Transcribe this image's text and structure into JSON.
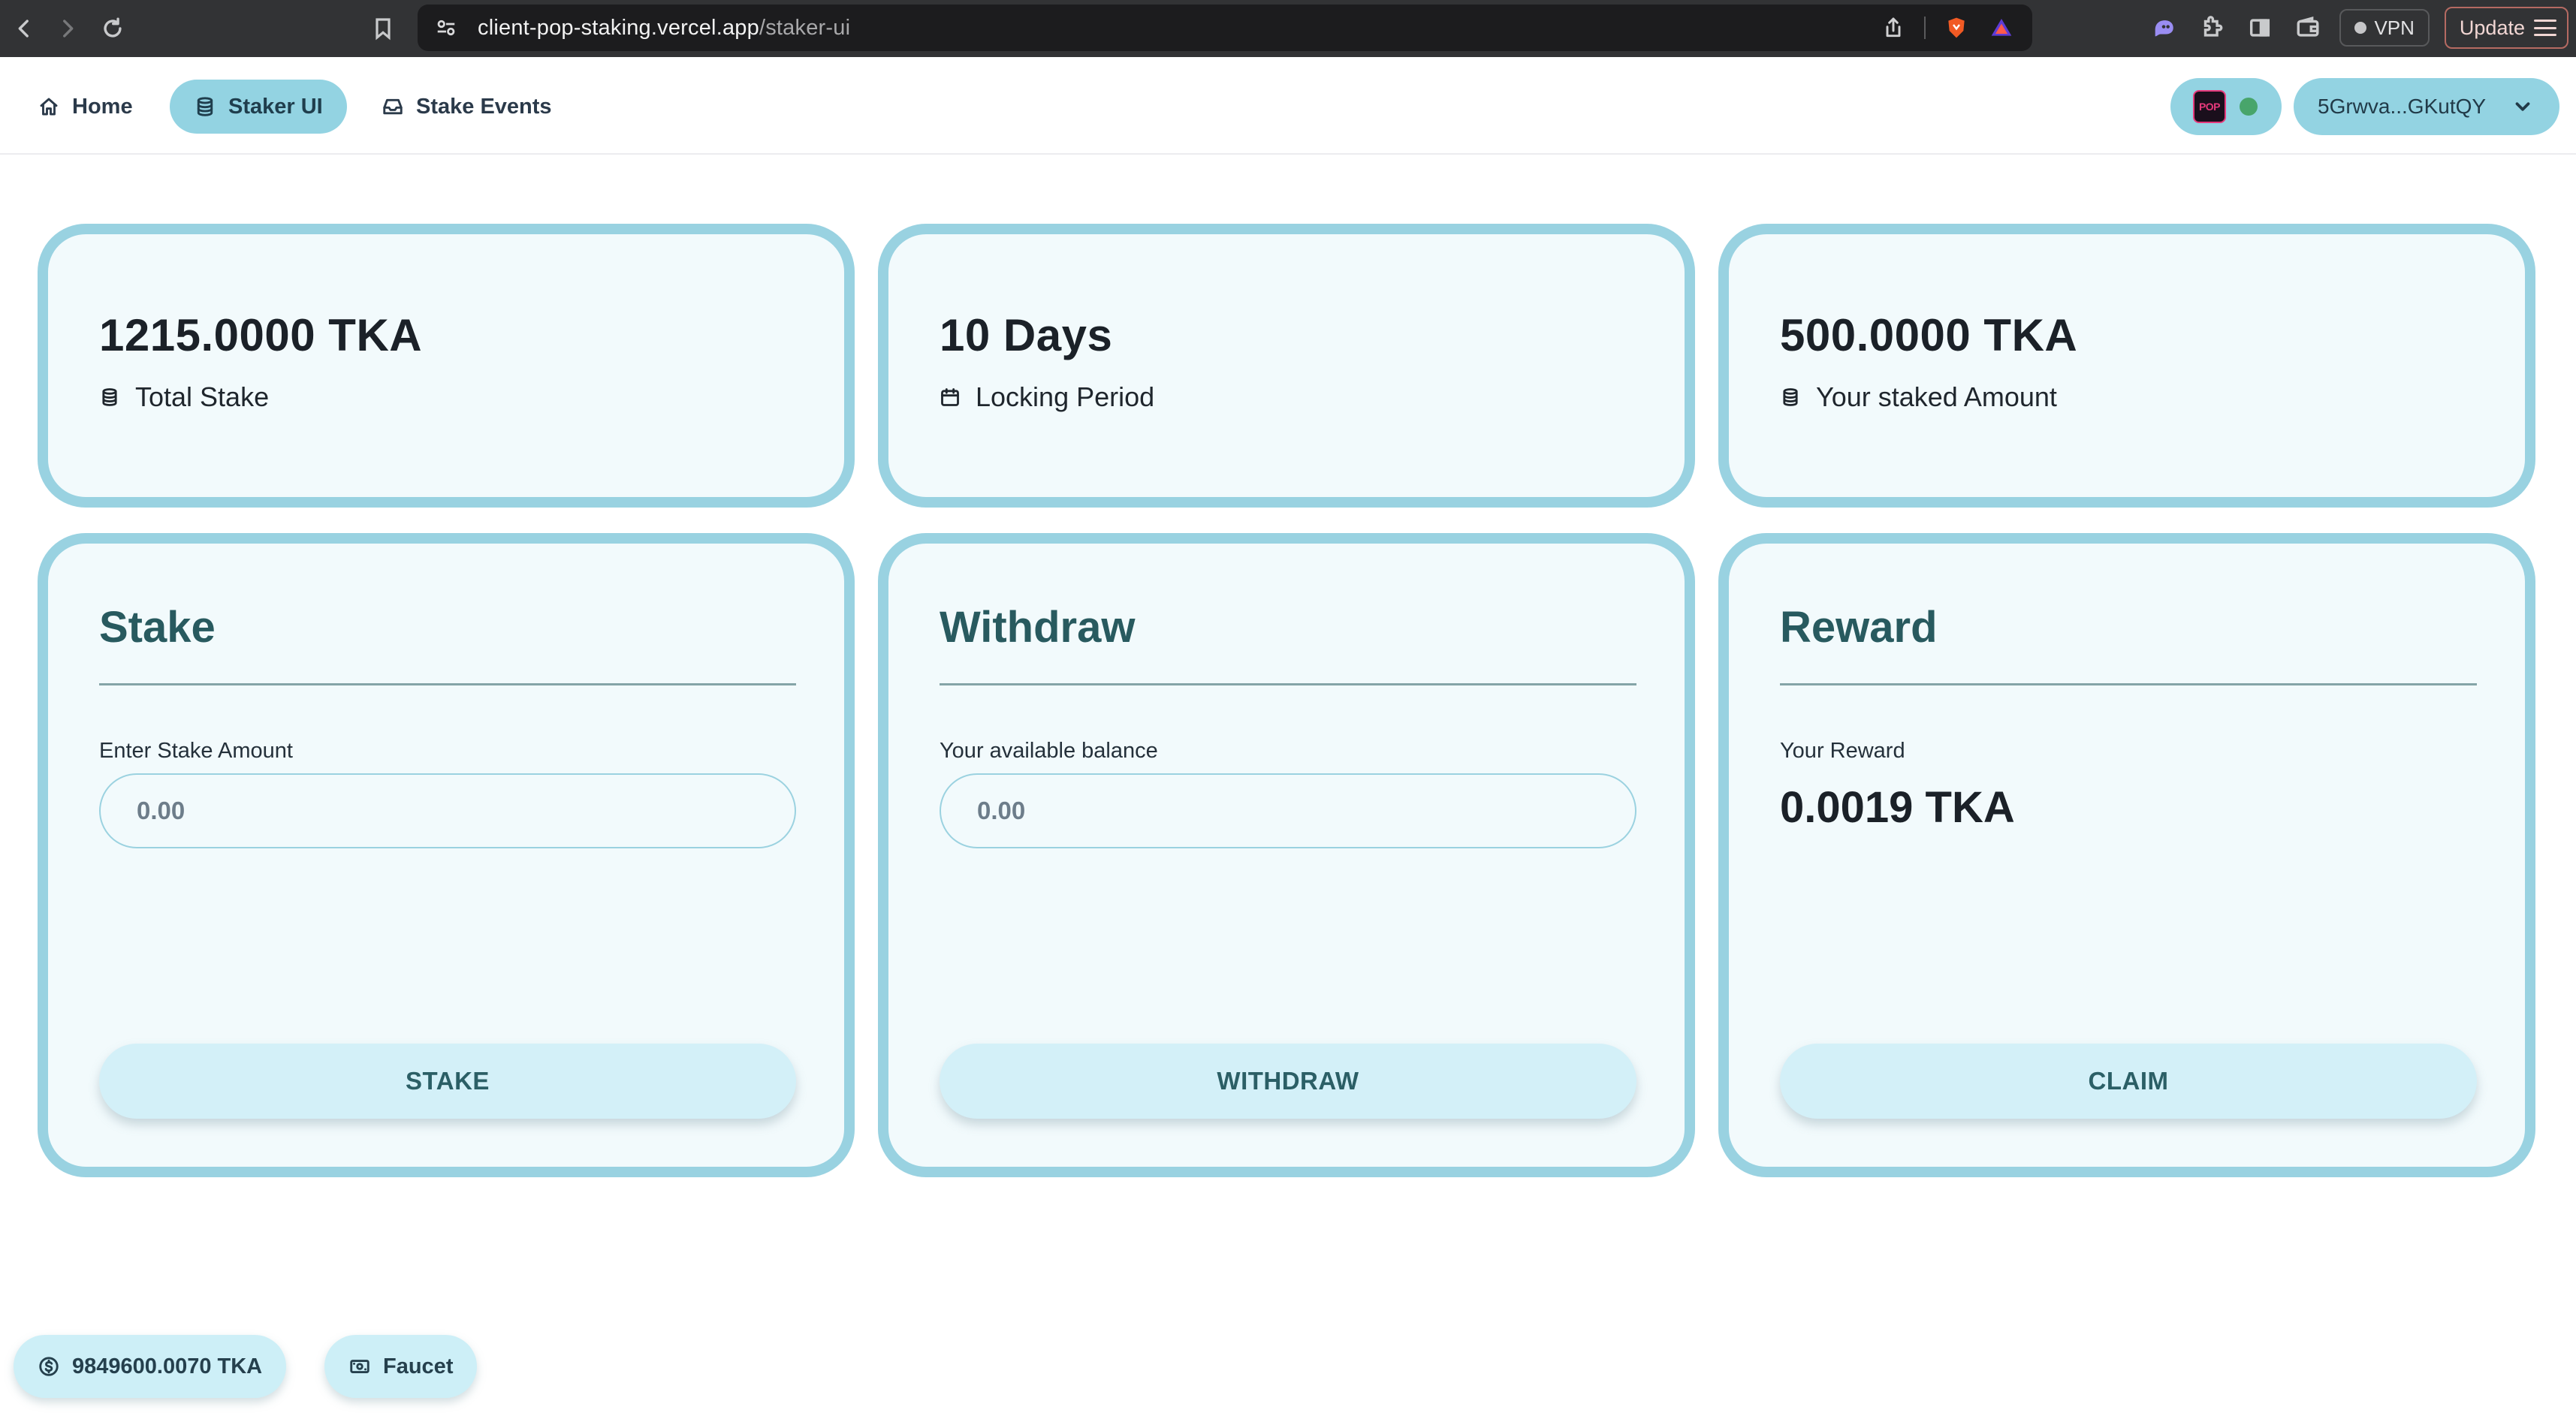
{
  "browser": {
    "url_host": "client-pop-staking.vercel.app",
    "url_path": "/staker-ui",
    "vpn_label": "VPN",
    "update_label": "Update"
  },
  "header": {
    "nav": [
      {
        "label": "Home",
        "icon": "home-icon"
      },
      {
        "label": "Staker UI",
        "icon": "database-icon",
        "active": true
      },
      {
        "label": "Stake Events",
        "icon": "inbox-icon"
      }
    ],
    "network_logo_text": "POP",
    "account_label": "5Grwva...GKutQY"
  },
  "stats": {
    "total_stake": {
      "value": "1215.0000 TKA",
      "label": "Total Stake",
      "icon": "database-icon"
    },
    "locking_period": {
      "value": "10 Days",
      "label": "Locking Period",
      "icon": "calendar-icon"
    },
    "staked_amount": {
      "value": "500.0000 TKA",
      "label": "Your staked Amount",
      "icon": "database-icon"
    }
  },
  "panels": {
    "stake": {
      "title": "Stake",
      "subtitle": "Enter Stake Amount",
      "placeholder": "0.00",
      "button": "STAKE"
    },
    "withdraw": {
      "title": "Withdraw",
      "subtitle": "Your available balance",
      "placeholder": "0.00",
      "button": "WITHDRAW"
    },
    "reward": {
      "title": "Reward",
      "subtitle": "Your Reward",
      "value": "0.0019 TKA",
      "button": "CLAIM"
    }
  },
  "footer": {
    "balance": "9849600.0070 TKA",
    "faucet_label": "Faucet"
  },
  "colors": {
    "accent": "#93d3e2",
    "card_border": "#99d2e1",
    "card_bg": "#f2fafc",
    "title_teal": "#285a5f",
    "status_online": "#48a56b"
  }
}
